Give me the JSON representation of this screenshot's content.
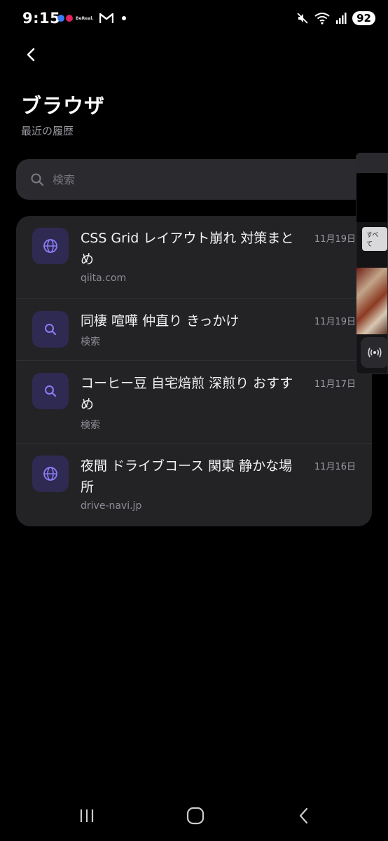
{
  "status_bar": {
    "time": "9:15",
    "bereal_label": "BeReal.",
    "battery": "92",
    "icons": [
      "bereal-icon",
      "gmail-icon",
      "notification-dot-icon",
      "mute-icon",
      "wifi-icon",
      "signal-icon",
      "battery-icon"
    ]
  },
  "header": {
    "back_icon": "chevron-left-icon",
    "title": "ブラウザ",
    "subtitle": "最近の履歴"
  },
  "search": {
    "placeholder": "検索",
    "icon": "search-icon"
  },
  "history": {
    "items": [
      {
        "icon": "globe-icon",
        "title": "CSS Grid レイアウト崩れ 対策まとめ",
        "subtitle": "qiita.com",
        "date": "11月19日"
      },
      {
        "icon": "search-icon",
        "title": "同棲 喧嘩 仲直り きっかけ",
        "subtitle": "検索",
        "date": "11月19日"
      },
      {
        "icon": "search-icon",
        "title": "コーヒー豆 自宅焙煎 深煎り おすすめ",
        "subtitle": "検索",
        "date": "11月17日"
      },
      {
        "icon": "globe-icon",
        "title": "夜間 ドライブコース 関東 静かな場所",
        "subtitle": "drive-navi.jp",
        "date": "11月16日"
      }
    ]
  },
  "peek": {
    "chip_label": "すべて",
    "icon": "broadcast-icon"
  },
  "nav": {
    "icons": [
      "recent-apps-icon",
      "home-icon",
      "back-icon"
    ]
  },
  "colors": {
    "background": "#000000",
    "card": "#232326",
    "icon_tile": "#2f2a52",
    "accent": "#8b7cf6",
    "muted_text": "#8d8d96"
  }
}
